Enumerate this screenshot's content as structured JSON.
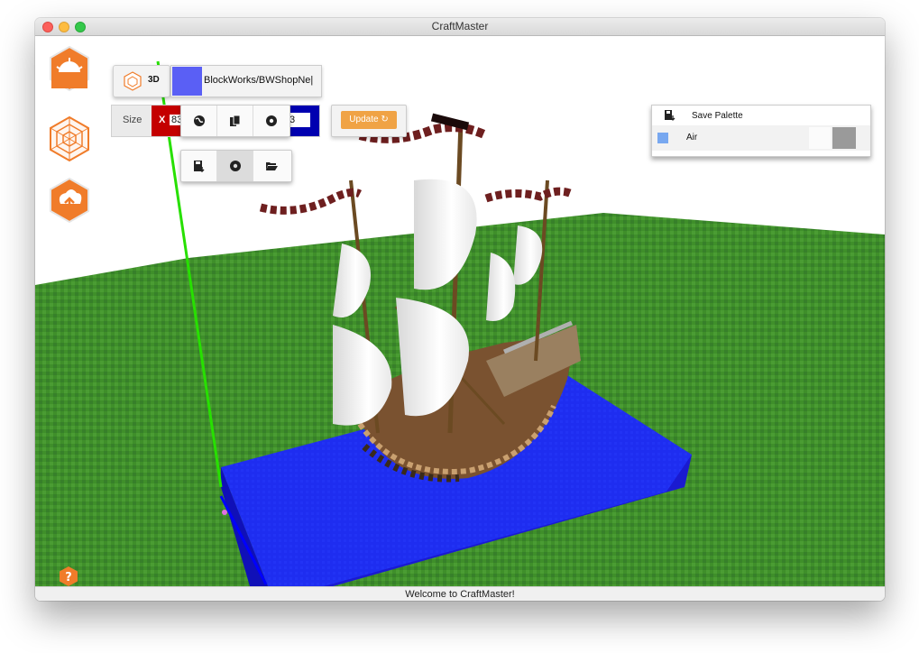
{
  "window": {
    "title": "CraftMaster"
  },
  "menu": [
    {
      "icon": "sun-hex-icon",
      "label": ""
    },
    {
      "icon": "web-hex-icon",
      "label": ""
    },
    {
      "icon": "upload-hex-icon",
      "label": ""
    }
  ],
  "toolbar": {
    "view_mode_label": "3D",
    "color_swatch": "#5a5ff5",
    "schematic_path": "BlockWorks/BWShopNe|",
    "size_label": "Size",
    "size_x_key": "X",
    "size_x_value": "83",
    "size_z_value": "3",
    "update_label": "Update ↻"
  },
  "popup_icons": [
    "globe-icon",
    "copy-icon",
    "gear-icon"
  ],
  "tools_icons": [
    "save-icon",
    "settings-cog-icon",
    "folder-open-icon"
  ],
  "palette": {
    "save_label": "Save Palette",
    "entries": [
      {
        "name": "Air",
        "color": "#78a8f0"
      }
    ]
  },
  "scene": {
    "grass_color": "#3f8f2a",
    "water_color": "#1e2df0",
    "axis_green": "#27e000"
  },
  "status": {
    "message": "Welcome to CraftMaster!"
  }
}
